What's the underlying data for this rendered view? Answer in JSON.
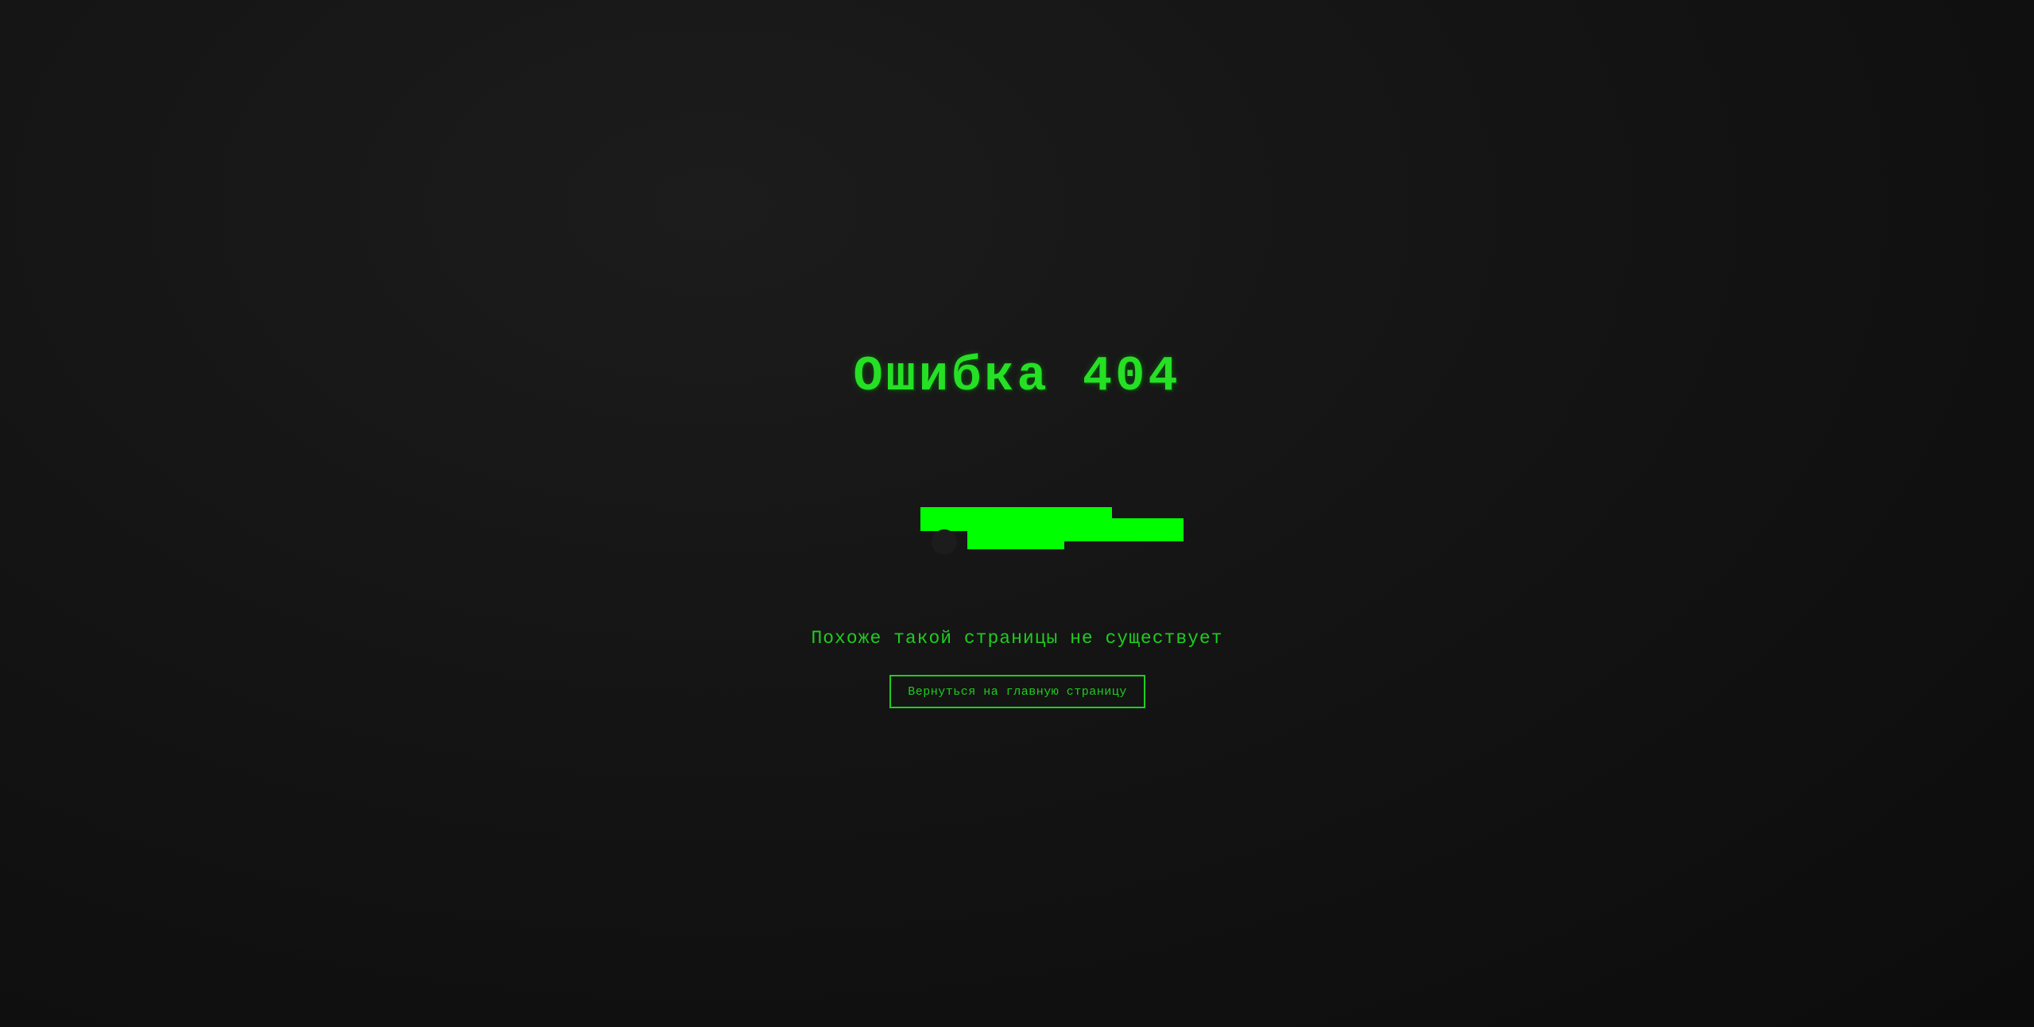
{
  "error": {
    "title": "Ошибка 404",
    "message": "Похоже такой страницы не существует"
  },
  "actions": {
    "home_button_label": "Вернуться на главную страницу"
  },
  "colors": {
    "accent": "#00ff00",
    "text_green": "#1fcc1f",
    "background": "#141414"
  }
}
